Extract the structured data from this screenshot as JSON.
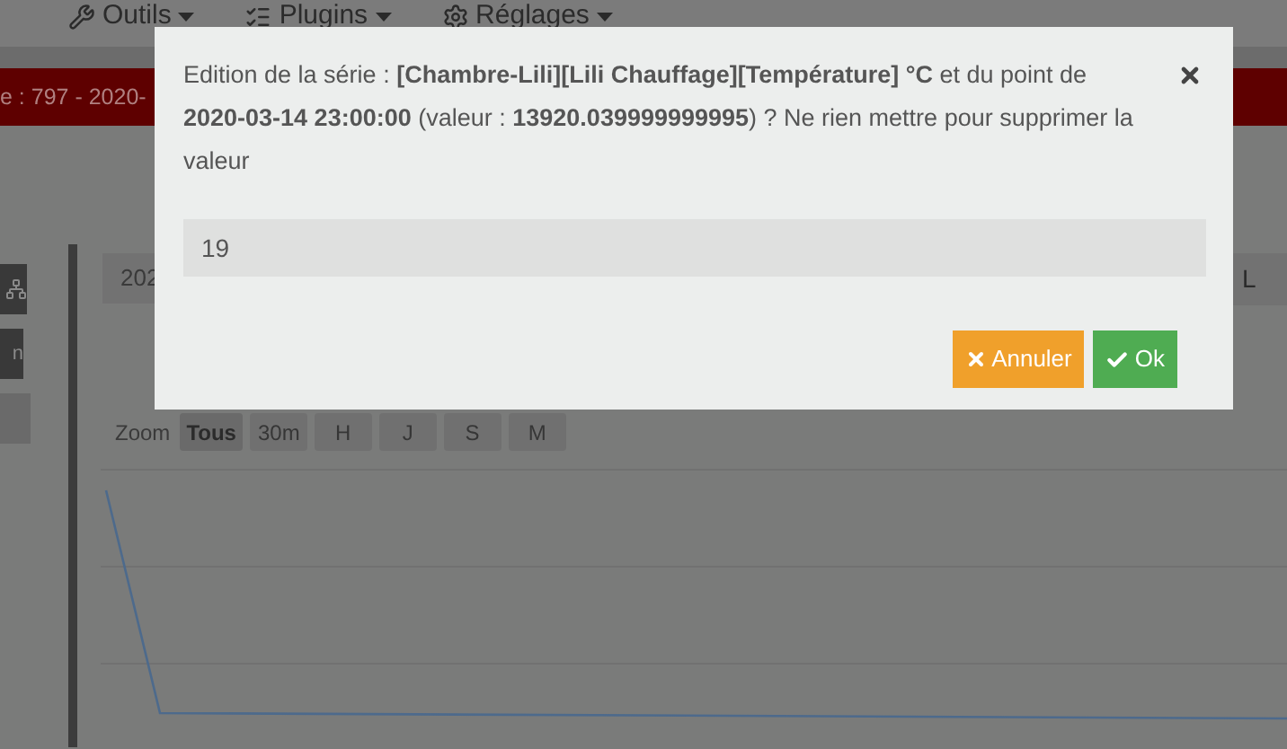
{
  "nav": {
    "items": [
      {
        "label": "Outils"
      },
      {
        "label": "Plugins"
      },
      {
        "label": "Réglages"
      }
    ]
  },
  "banner": {
    "text": "e : 797 - 2020-"
  },
  "sidebar": {
    "button_label": "n"
  },
  "date_field": {
    "value": "202"
  },
  "right_field": {
    "value": "L"
  },
  "zoom": {
    "label": "Zoom",
    "buttons": [
      {
        "label": "Tous",
        "selected": true
      },
      {
        "label": "30m",
        "selected": false
      },
      {
        "label": "H",
        "selected": false
      },
      {
        "label": "J",
        "selected": false
      },
      {
        "label": "S",
        "selected": false
      },
      {
        "label": "M",
        "selected": false
      }
    ]
  },
  "dialog": {
    "message": "Edition de la série : **[Chambre-Lili][Lili Chauffage][Température] °C** et du point de **2020-03-14 23:00:00** (valeur : **13920.039999999995**) ? Ne rien mettre pour supprimer la valeur",
    "value": "19",
    "buttons": [
      {
        "label": "Annuler",
        "kind": "cancel"
      },
      {
        "label": "Ok",
        "kind": "confirm"
      }
    ]
  }
}
